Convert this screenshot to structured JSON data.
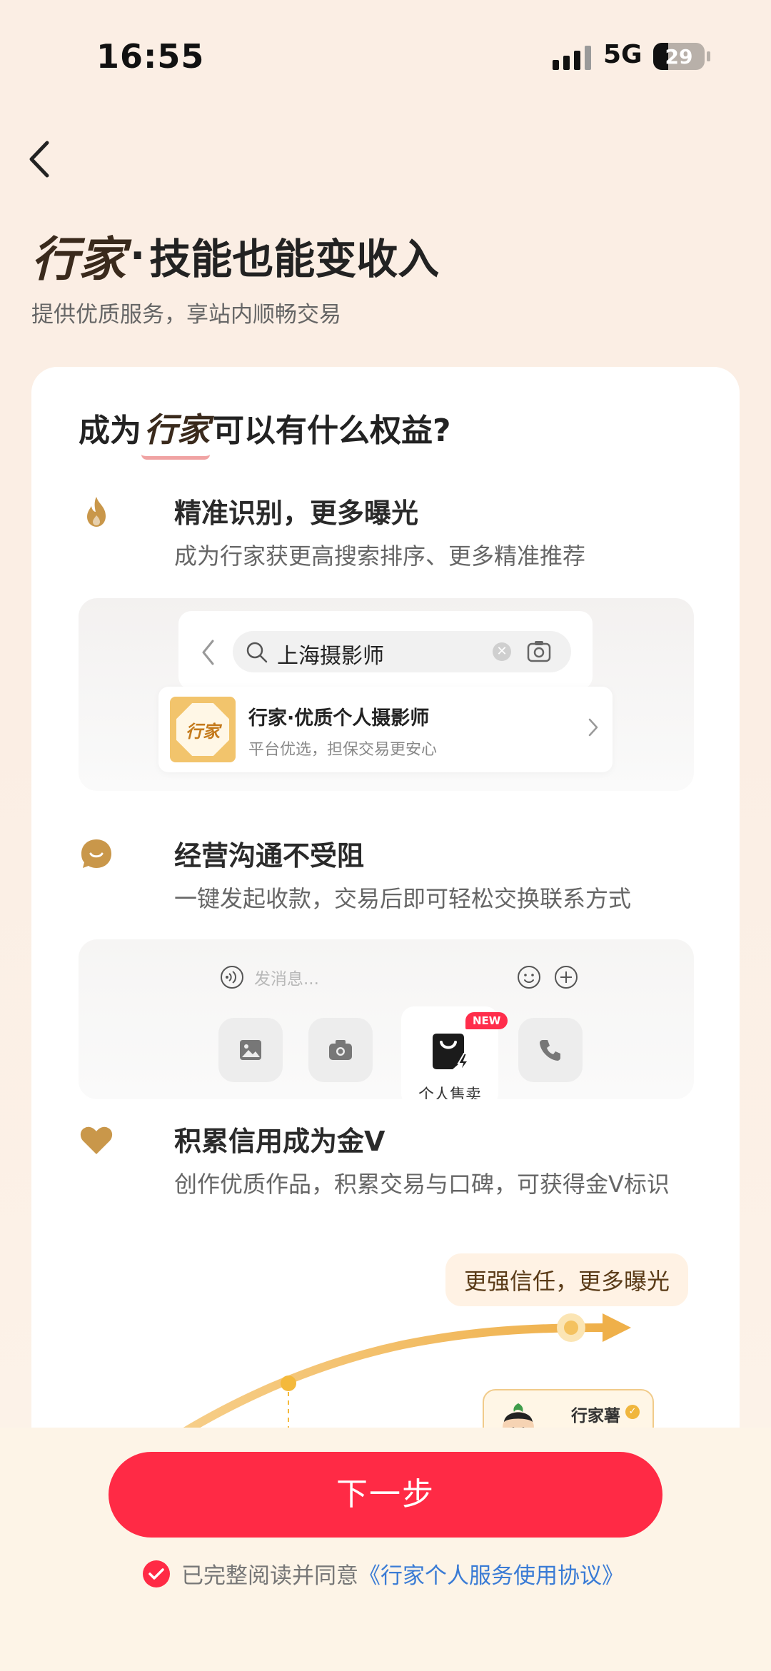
{
  "status_bar": {
    "time": "16:55",
    "network": "5G",
    "battery": "29",
    "battery_level": 0.29
  },
  "header": {
    "brand": "行家",
    "separator": "·",
    "headline": "技能也能变收入",
    "subtitle": "提供优质服务，享站内顺畅交易"
  },
  "card": {
    "title_prefix": "成为",
    "title_brand": "行家",
    "title_suffix": "可以有什么权益?",
    "benefits": [
      {
        "icon": "flame-icon",
        "title": "精准识别，更多曝光",
        "desc": "成为行家获更高搜索排序、更多精准推荐"
      },
      {
        "icon": "chat-bubble-icon",
        "title": "经营沟通不受阻",
        "desc": "一键发起收款，交易后即可轻松交换联系方式"
      },
      {
        "icon": "heart-icon",
        "title": "积累信用成为金V",
        "desc": "创作优质作品，积累交易与口碑，可获得金V标识"
      }
    ],
    "search_demo": {
      "query": "上海摄影师",
      "result_logo": "行家",
      "result_title": "行家·优质个人摄影师",
      "result_subtitle": "平台优选，担保交易更安心"
    },
    "chat_demo": {
      "placeholder": "发消息...",
      "new_badge": "NEW",
      "sell_label": "个人售卖"
    },
    "trust_demo": {
      "bubble": "更强信任，更多曝光",
      "profile_name": "行家薯"
    }
  },
  "footer": {
    "next_label": "下一步",
    "agree_text": "已完整阅读并同意",
    "agree_link": "《行家个人服务使用协议》"
  },
  "colors": {
    "accent": "#ff2a45",
    "gold": "#c9974a",
    "link": "#3a7bd5"
  }
}
